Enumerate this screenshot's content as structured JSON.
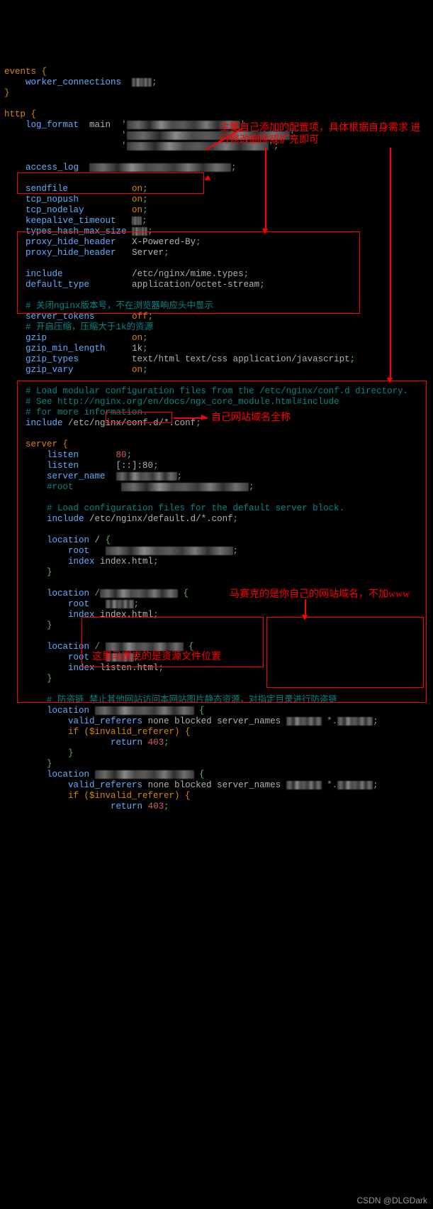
{
  "events": {
    "open": "events {",
    "worker": "worker_connections",
    "close": "}"
  },
  "http": {
    "open": "http {",
    "log_format": {
      "k": "log_format",
      "v": "main"
    },
    "access_log": "access_log",
    "sendfile": {
      "k": "sendfile",
      "v": "on"
    },
    "tcp_nopush": {
      "k": "tcp_nopush",
      "v": "on"
    },
    "tcp_nodelay": {
      "k": "tcp_nodelay",
      "v": "on"
    },
    "keepalive_timeout": {
      "k": "keepalive_timeout"
    },
    "types_hash_max_size": {
      "k": "types_hash_max_size"
    },
    "proxy_hide1": {
      "k": "proxy_hide_header",
      "v": "X-Powered-By"
    },
    "proxy_hide2": {
      "k": "proxy_hide_header",
      "v": "Server"
    },
    "include1": {
      "k": "include",
      "v": "/etc/nginx/mime.types"
    },
    "default_type": {
      "k": "default_type",
      "v": "application/octet-stream"
    },
    "cmt_tokens": "# 关闭nginx版本号，不在浏览器响应头中显示",
    "server_tokens": {
      "k": "server_tokens",
      "v": "off"
    },
    "cmt_gzip": "# 开启压缩，压缩大于1k的资源",
    "gzip": {
      "k": "gzip",
      "v": "on"
    },
    "gzip_min_length": {
      "k": "gzip_min_length",
      "v": "1k"
    },
    "gzip_types": {
      "k": "gzip_types",
      "v": "text/html text/css application/javascript"
    },
    "gzip_vary": {
      "k": "gzip_vary",
      "v": "on"
    },
    "cmt_load1": "# Load modular configuration files from the /etc/nginx/conf.d directory.",
    "cmt_load2": "# See http://nginx.org/en/docs/ngx_core_module.html#include",
    "cmt_load3": "# for more information.",
    "include2": {
      "k": "include",
      "v": "/etc/nginx/conf.d/*.conf"
    }
  },
  "server": {
    "open": "server {",
    "listen1": {
      "k": "listen",
      "v": "80"
    },
    "listen2": {
      "k": "listen",
      "v": "[::]:80"
    },
    "server_name": "server_name",
    "root_cmt": "#root",
    "cmt_load": "# Load configuration files for the default server block.",
    "include": {
      "k": "include",
      "v": "/etc/nginx/default.d/*.conf"
    },
    "loc1": {
      "k": "location",
      "path": "/",
      "root": "root",
      "idx": {
        "k": "index",
        "v": "index.html"
      }
    },
    "loc2": {
      "k": "location",
      "root": "root",
      "idx": {
        "k": "index",
        "v": "index.html"
      }
    },
    "loc3": {
      "k": "location",
      "root": "root",
      "idx": {
        "k": "index",
        "v": "listen.html"
      }
    },
    "hotlink_cmt": "# 防盗链 禁止其他网站访问本网站图片静态资源，对指定目录进行防盗链",
    "loc4": {
      "k": "location",
      "valid": {
        "k": "valid_referers",
        "v": "none blocked server_names"
      },
      "if": "if ($invalid_referer) {",
      "ret": {
        "k": "return",
        "v": "403"
      }
    },
    "loc5": {
      "k": "location",
      "valid": {
        "k": "valid_referers",
        "v": "none blocked server_names"
      },
      "if": "if ($invalid_referer) {",
      "ret": {
        "k": "return",
        "v": "403"
      }
    }
  },
  "annotations": {
    "a1": "主要自己添加的配置项，具体根据自身需求\n进行修改删除或扩充即可",
    "a2": "自己网站域名全称",
    "a3": "马赛克的是你自己的网站域名，不加www",
    "a4": "这里马赛克的是资源文件位置"
  },
  "watermark": "CSDN @DLGDark"
}
